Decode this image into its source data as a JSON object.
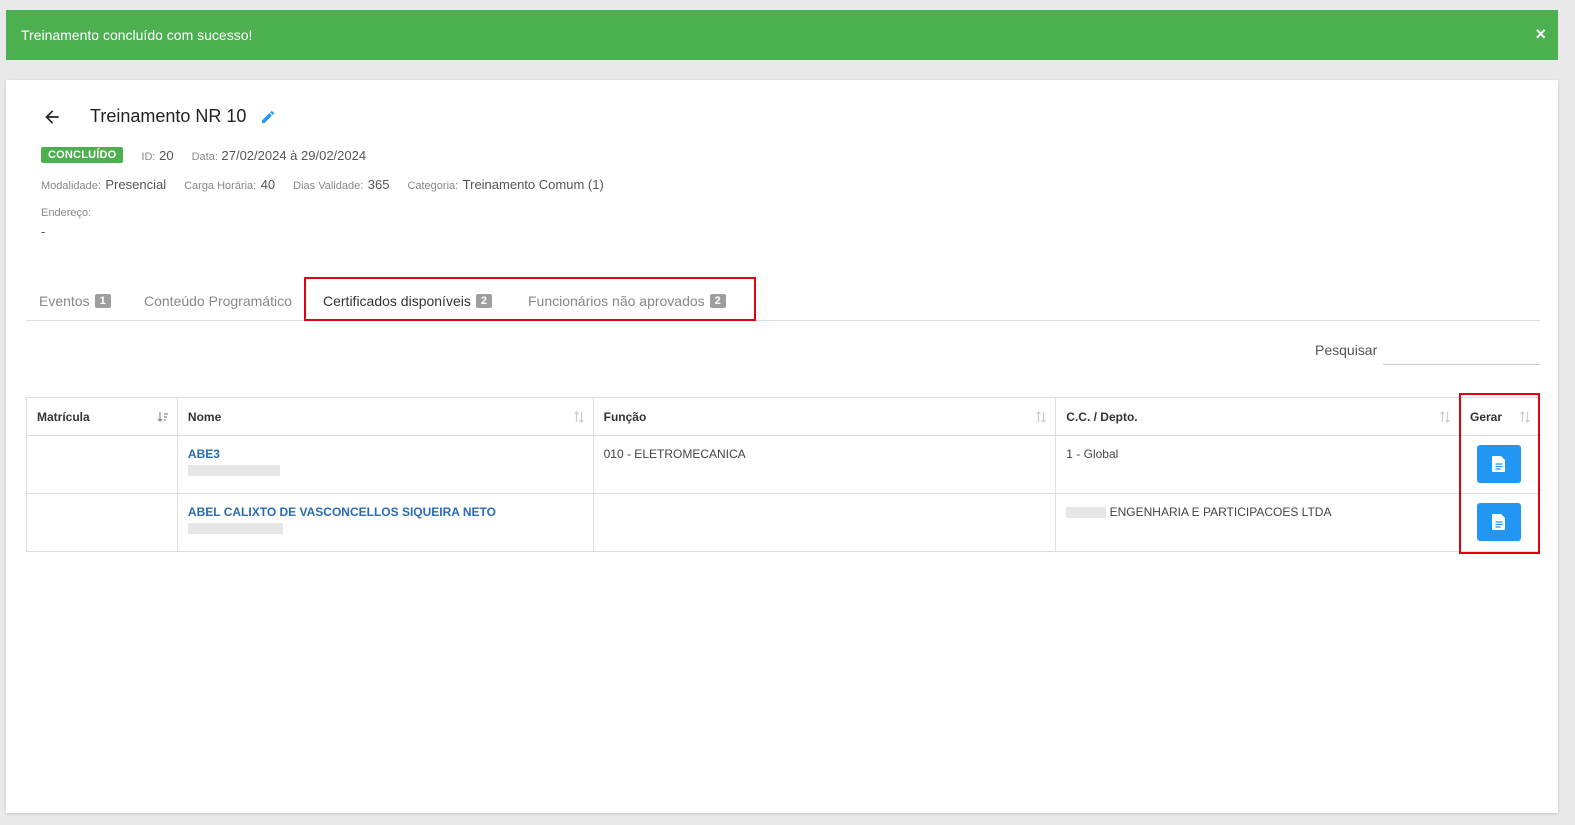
{
  "alert": {
    "message": "Treinamento concluído com sucesso!",
    "close_label": "×"
  },
  "header": {
    "title": "Treinamento NR 10"
  },
  "meta": {
    "status": "CONCLUÍDO",
    "id_label": "ID:",
    "id_value": "20",
    "date_label": "Data:",
    "date_value": "27/02/2024 à 29/02/2024",
    "modalidade_label": "Modalidade:",
    "modalidade_value": "Presencial",
    "carga_label": "Carga Horária:",
    "carga_value": "40",
    "validade_label": "Dias Validade:",
    "validade_value": "365",
    "categoria_label": "Categoria:",
    "categoria_value": "Treinamento Comum (1)",
    "endereco_label": "Endereço:",
    "endereco_value": "-"
  },
  "tabs": [
    {
      "label": "Eventos",
      "count": "1"
    },
    {
      "label": "Conteúdo Programático",
      "count": ""
    },
    {
      "label": "Certificados disponíveis",
      "count": "2"
    },
    {
      "label": "Funcionários não aprovados",
      "count": "2"
    }
  ],
  "search": {
    "label": "Pesquisar",
    "placeholder": ""
  },
  "table": {
    "headers": [
      "Matrícula",
      "Nome",
      "Função",
      "C.C. / Depto.",
      "Gerar"
    ],
    "rows": [
      {
        "matricula": "",
        "nome": "ABE3",
        "funcao": "010 - ELETROMECANICA",
        "depto": "1 - Global"
      },
      {
        "matricula": "",
        "nome": "ABEL CALIXTO DE VASCONCELLOS SIQUEIRA NETO",
        "funcao": "",
        "depto": "ENGENHARIA E PARTICIPACOES LTDA"
      }
    ]
  },
  "colors": {
    "success": "#4caf50",
    "accent": "#2196f3",
    "link": "#2a6bb3",
    "highlight": "#e3000f"
  },
  "icons": [
    "close-icon",
    "arrow-left-icon",
    "pencil-icon",
    "sort-icon",
    "sort-asc-icon",
    "document-icon"
  ]
}
